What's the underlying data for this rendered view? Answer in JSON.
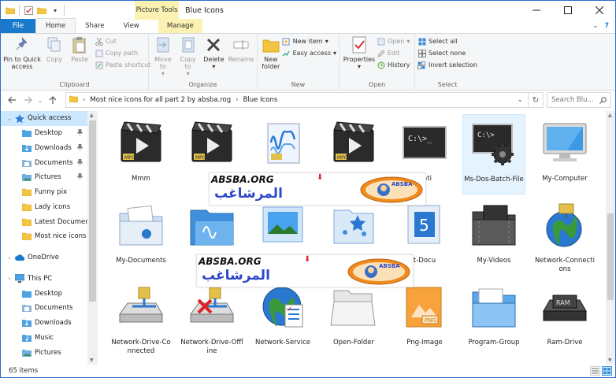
{
  "window": {
    "title": "Blue Icons",
    "context_tab": "Picture Tools",
    "controls": [
      "minimize",
      "maximize",
      "close"
    ]
  },
  "tabs": {
    "file": "File",
    "home": "Home",
    "share": "Share",
    "view": "View",
    "manage": "Manage"
  },
  "ribbon": {
    "clipboard": {
      "label": "Clipboard",
      "pin": "Pin to Quick access",
      "copy": "Copy",
      "paste": "Paste",
      "cut": "Cut",
      "copy_path": "Copy path",
      "paste_shortcut": "Paste shortcut"
    },
    "organize": {
      "label": "Organize",
      "move_to": "Move to",
      "copy_to": "Copy to",
      "delete": "Delete",
      "rename": "Rename"
    },
    "new": {
      "label": "New",
      "new_folder": "New folder",
      "new_item": "New item",
      "easy_access": "Easy access"
    },
    "open": {
      "label": "Open",
      "properties": "Properties",
      "open": "Open",
      "edit": "Edit",
      "history": "History"
    },
    "select": {
      "label": "Select",
      "select_all": "Select all",
      "select_none": "Select none",
      "invert": "Invert selection"
    }
  },
  "address": {
    "path": [
      "Most nice icons for all part 2 by absba.rog",
      "Blue Icons"
    ],
    "search_placeholder": "Search Blu..."
  },
  "sidebar": {
    "items": [
      {
        "label": "Quick access",
        "type": "quick",
        "level": 0,
        "selected": true
      },
      {
        "label": "Desktop",
        "type": "desktop",
        "level": 1,
        "pinned": true
      },
      {
        "label": "Downloads",
        "type": "download",
        "level": 1,
        "pinned": true
      },
      {
        "label": "Documents",
        "type": "docs",
        "level": 1,
        "pinned": true
      },
      {
        "label": "Pictures",
        "type": "pics",
        "level": 1,
        "pinned": true
      },
      {
        "label": "Funny pix",
        "type": "folder",
        "level": 1
      },
      {
        "label": "Lady icons",
        "type": "folder",
        "level": 1
      },
      {
        "label": "Latest Documen",
        "type": "folder",
        "level": 1
      },
      {
        "label": "Most nice icons f",
        "type": "folder",
        "level": 1
      },
      {
        "label": "",
        "type": "spacer",
        "level": 0
      },
      {
        "label": "OneDrive",
        "type": "cloud",
        "level": 0
      },
      {
        "label": "",
        "type": "spacer",
        "level": 0
      },
      {
        "label": "This PC",
        "type": "pc",
        "level": 0
      },
      {
        "label": "Desktop",
        "type": "desktop",
        "level": 1
      },
      {
        "label": "Documents",
        "type": "docs",
        "level": 1
      },
      {
        "label": "Downloads",
        "type": "download",
        "level": 1
      },
      {
        "label": "Music",
        "type": "music",
        "level": 1
      },
      {
        "label": "Pictures",
        "type": "pics",
        "level": 1
      }
    ]
  },
  "files": [
    {
      "name": "Mmm",
      "kind": "clapper"
    },
    {
      "name": "M",
      "kind": "clapper"
    },
    {
      "name": "",
      "kind": "wave"
    },
    {
      "name": "",
      "kind": "clapper"
    },
    {
      "name": "icati",
      "kind": "cmd"
    },
    {
      "name": "Ms-Dos-Batch-File",
      "kind": "batch",
      "selected": true
    },
    {
      "name": "My-Computer",
      "kind": "monitor"
    },
    {
      "name": "My-Documents",
      "kind": "mydocs"
    },
    {
      "name": "My-",
      "kind": "music"
    },
    {
      "name": "",
      "kind": "pictures"
    },
    {
      "name": "",
      "kind": "favorites"
    },
    {
      "name": "t-Docu",
      "kind": "recent"
    },
    {
      "name": "My-Videos",
      "kind": "videos"
    },
    {
      "name": "Network-Connections",
      "kind": "globe"
    },
    {
      "name": "Network-Drive-Connected",
      "kind": "netdrive"
    },
    {
      "name": "Network-Drive-Offline",
      "kind": "netdrive-off"
    },
    {
      "name": "Network-Service",
      "kind": "service"
    },
    {
      "name": "Open-Folder",
      "kind": "openfolder"
    },
    {
      "name": "Png-Image",
      "kind": "png"
    },
    {
      "name": "Program-Group",
      "kind": "progroup"
    },
    {
      "name": "Ram-Drive",
      "kind": "ram"
    }
  ],
  "watermark": {
    "latin": "ABSBA.ORG",
    "arabic": "المرشاغب",
    "logo_text": "ABSBA"
  },
  "status": {
    "count": "65 items"
  },
  "colors": {
    "accent": "#1979ca",
    "selection": "#cce8ff",
    "context_tab": "#fbf1b1",
    "watermark_text": "#2f48c8"
  }
}
